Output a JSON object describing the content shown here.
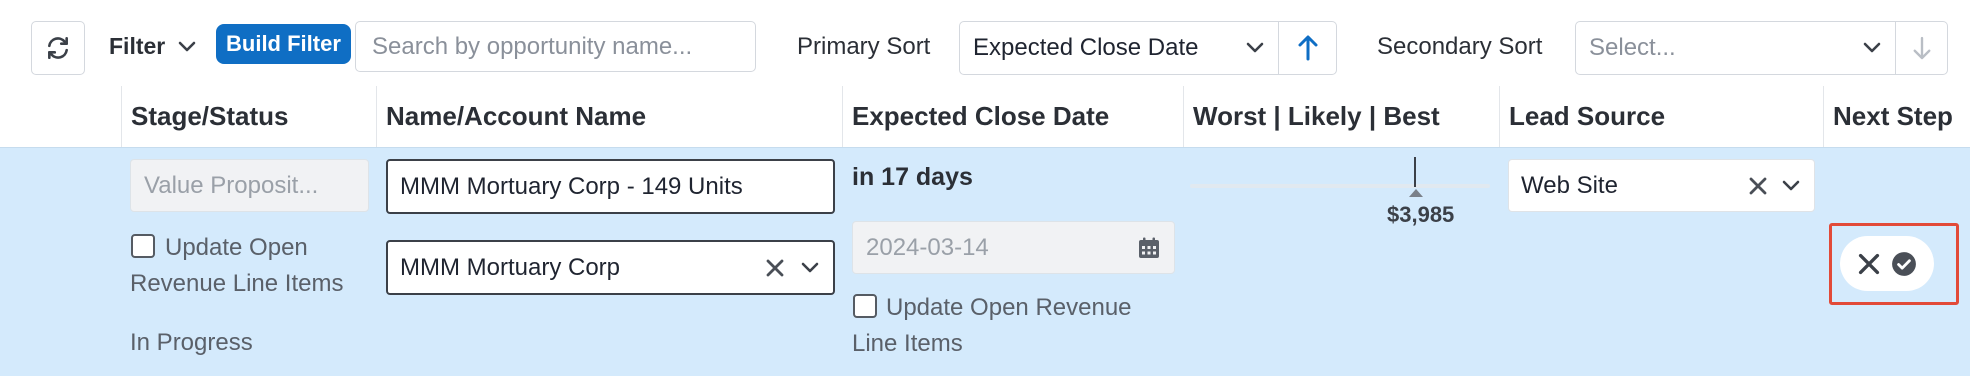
{
  "toolbar": {
    "filter_label": "Filter",
    "build_filter_label": "Build Filter",
    "search_placeholder": "Search by opportunity name...",
    "primary_sort_label": "Primary Sort",
    "primary_sort_value": "Expected Close Date",
    "secondary_sort_label": "Secondary Sort",
    "secondary_sort_placeholder": "Select..."
  },
  "columns": [
    "Stage/Status",
    "Name/Account Name",
    "Expected Close Date",
    "Worst | Likely | Best",
    "Lead Source",
    "Next Step"
  ],
  "row": {
    "stage_value": "Value Proposit...",
    "update_rli_label_1": "Update Open",
    "update_rli_label_2": "Revenue Line Items",
    "status": "In Progress",
    "name_value": "MMM Mortuary Corp - 149 Units",
    "account_value": "MMM Mortuary Corp",
    "close_relative": "in 17 days",
    "close_date_value": "2024-03-14",
    "update_rli_date_label_1": "Update Open Revenue",
    "update_rli_date_label_2": "Line Items",
    "likely_amount": "$3,985",
    "lead_source": "Web Site"
  },
  "colors": {
    "accent": "#0f6ec4",
    "row_highlight": "#d4eafc",
    "action_outline": "#e24a38"
  }
}
